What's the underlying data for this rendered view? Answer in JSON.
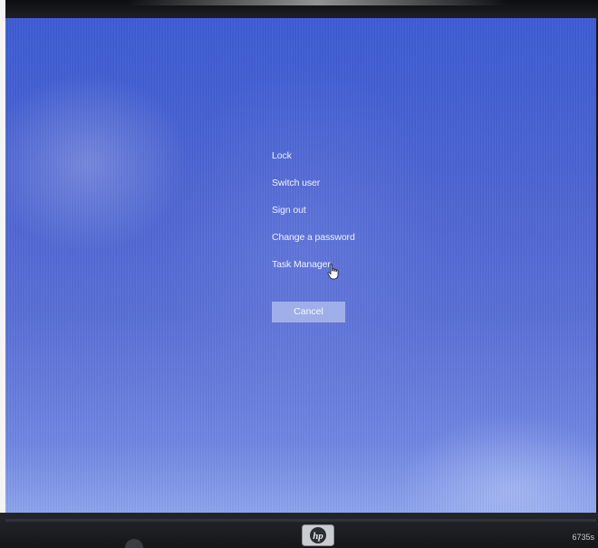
{
  "menu": {
    "items": [
      {
        "label": "Lock"
      },
      {
        "label": "Switch user"
      },
      {
        "label": "Sign out"
      },
      {
        "label": "Change a password"
      },
      {
        "label": "Task Manager"
      }
    ]
  },
  "cancel": {
    "label": "Cancel"
  },
  "device": {
    "brand_logo": "hp",
    "model": "6735s"
  },
  "icons": {
    "pointer": "hand-pointer-icon",
    "logo": "hp-logo-icon"
  },
  "colors": {
    "screen_blue": "#4a63d2",
    "menu_text": "#eef2ff",
    "cancel_bg": "#aab9eb"
  }
}
